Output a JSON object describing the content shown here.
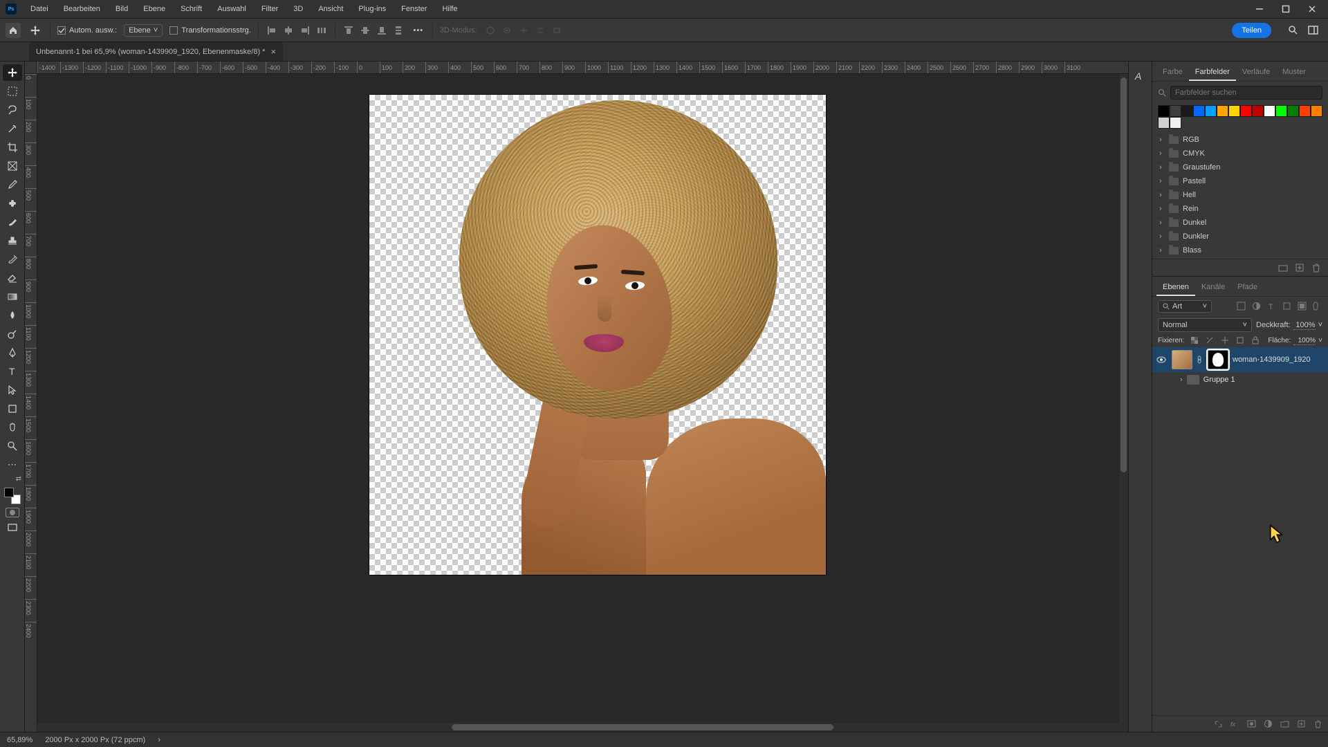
{
  "menu": {
    "items": [
      "Datei",
      "Bearbeiten",
      "Bild",
      "Ebene",
      "Schrift",
      "Auswahl",
      "Filter",
      "3D",
      "Ansicht",
      "Plug-ins",
      "Fenster",
      "Hilfe"
    ]
  },
  "options": {
    "auto_select_label": "Autom. ausw.:",
    "auto_select_target": "Ebene",
    "transform_controls": "Transformationsstrg.",
    "mode_3d": "3D-Modus:",
    "share_label": "Teilen"
  },
  "document": {
    "tab_title": "Unbenannt-1 bei 65,9% (woman-1439909_1920, Ebenenmaske/8) *"
  },
  "ruler_h": [
    "-1400",
    "-1300",
    "-1200",
    "-1100",
    "-1000",
    "-900",
    "-800",
    "-700",
    "-600",
    "-500",
    "-400",
    "-300",
    "-200",
    "-100",
    "0",
    "100",
    "200",
    "300",
    "400",
    "500",
    "600",
    "700",
    "800",
    "900",
    "1000",
    "1100",
    "1200",
    "1300",
    "1400",
    "1500",
    "1600",
    "1700",
    "1800",
    "1900",
    "2000",
    "2100",
    "2200",
    "2300",
    "2400",
    "2500",
    "2600",
    "2700",
    "2800",
    "2900",
    "3000",
    "3100"
  ],
  "ruler_v": [
    "0",
    "100",
    "200",
    "300",
    "400",
    "500",
    "600",
    "700",
    "800",
    "900",
    "1000",
    "1100",
    "1200",
    "1300",
    "1400",
    "1500",
    "1600",
    "1700",
    "1800",
    "1900",
    "2000",
    "2100",
    "2200",
    "2300",
    "2400"
  ],
  "swatches_panel": {
    "tabs": [
      "Farbe",
      "Farbfelder",
      "Verläufe",
      "Muster"
    ],
    "active_tab": 1,
    "search_placeholder": "Farbfelder suchen",
    "row_colors": [
      "#000000",
      "#404040",
      "#1a1a1a",
      "#0067ff",
      "#00a0ff",
      "#ffa500",
      "#ffd400",
      "#ff0000",
      "#c00000",
      "#ffffff",
      "#00ff00",
      "#008000",
      "#ff4000",
      "#ff8000",
      "#d0d0d0",
      "#f0f0f0"
    ],
    "folders": [
      "RGB",
      "CMYK",
      "Graustufen",
      "Pastell",
      "Hell",
      "Rein",
      "Dunkel",
      "Dunkler",
      "Blass"
    ]
  },
  "layers_panel": {
    "tabs": [
      "Ebenen",
      "Kanäle",
      "Pfade"
    ],
    "active_tab": 0,
    "kind_label": "Art",
    "blend_mode": "Normal",
    "opacity_label": "Deckkraft:",
    "opacity_value": "100%",
    "lock_label": "Fixieren:",
    "fill_label": "Fläche:",
    "fill_value": "100%",
    "layers": [
      {
        "visible": true,
        "name": "woman-1439909_1920",
        "has_mask": true,
        "selected": true
      },
      {
        "visible": false,
        "name": "Gruppe 1",
        "is_group": true
      }
    ]
  },
  "status": {
    "zoom": "65,89%",
    "doc_info": "2000 Px x 2000 Px (72 ppcm)"
  }
}
